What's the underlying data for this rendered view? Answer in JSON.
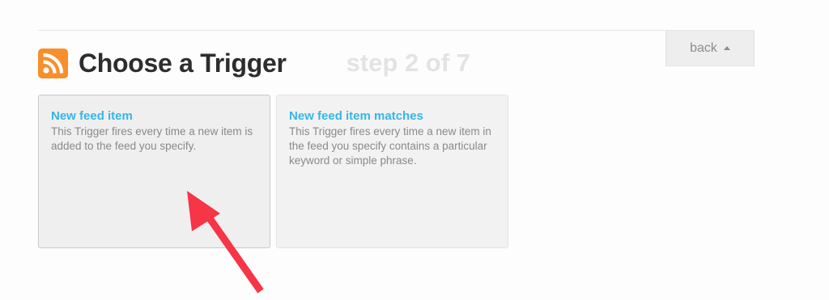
{
  "header": {
    "title": "Choose a Trigger",
    "step": "step 2 of 7",
    "icon": "rss-feed-icon",
    "icon_color": "#f78f2b"
  },
  "back_button": {
    "label": "back",
    "icon": "caret-up-icon"
  },
  "triggers": [
    {
      "title": "New feed item",
      "description": "This Trigger fires every time a new item is added to the feed you specify."
    },
    {
      "title": "New feed item matches",
      "description": "This Trigger fires every time a new item in the feed you specify contains a particular keyword or simple phrase."
    }
  ],
  "annotation": {
    "icon": "red-arrow-icon",
    "color": "#f63546"
  },
  "colors": {
    "accent": "#36b6e6",
    "title": "#2d2d2d",
    "muted_step": "#e3e3e3"
  }
}
